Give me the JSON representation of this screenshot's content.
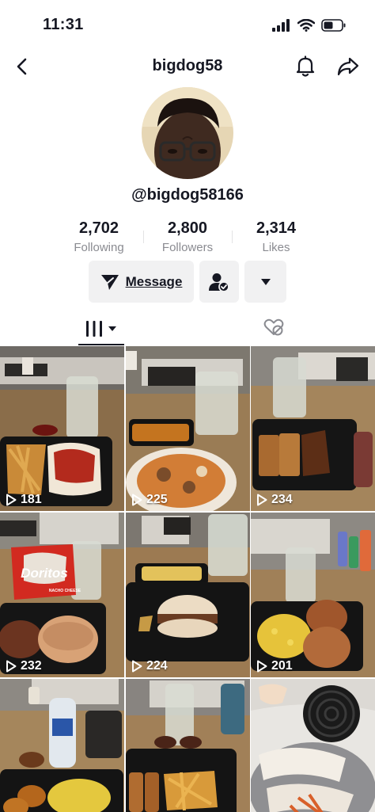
{
  "status_bar": {
    "time": "11:31"
  },
  "nav": {
    "title": "bigdog58"
  },
  "profile": {
    "handle": "@bigdog58166",
    "stats": [
      {
        "value": "2,702",
        "label": "Following"
      },
      {
        "value": "2,800",
        "label": "Followers"
      },
      {
        "value": "2,314",
        "label": "Likes"
      }
    ]
  },
  "actions": {
    "message_label": "Message"
  },
  "tabs": [
    {
      "icon": "grid-icon",
      "selected": true
    },
    {
      "icon": "liked-hidden-icon",
      "selected": false
    }
  ],
  "videos": [
    {
      "views": "181"
    },
    {
      "views": "225"
    },
    {
      "views": "234"
    },
    {
      "views": "232"
    },
    {
      "views": "224"
    },
    {
      "views": "201"
    },
    {
      "views": ""
    },
    {
      "views": ""
    },
    {
      "views": ""
    }
  ],
  "thumb_text": {
    "chips_brand": "Doritos",
    "chips_flavor": "NACHO CHEESE"
  },
  "colors": {
    "text": "#161823",
    "secondary": "#8a8b91",
    "button_bg": "#f1f1f2",
    "overlay_text": "#ffffff"
  }
}
